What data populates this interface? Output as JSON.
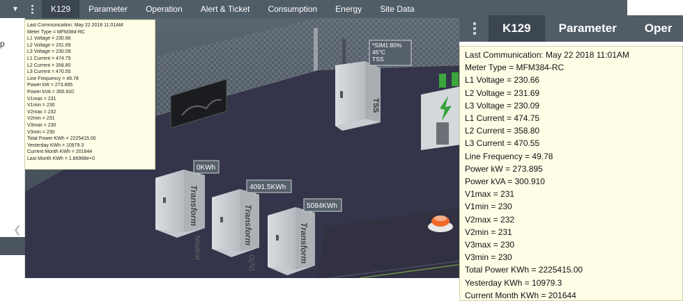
{
  "nav": {
    "tabs": [
      "K129",
      "Parameter",
      "Operation",
      "Alert & Ticket",
      "Consumption",
      "Energy",
      "Site Data"
    ],
    "active": "K129"
  },
  "left_panel": {
    "text": "p"
  },
  "zoom_nav": {
    "tabs": [
      "K129",
      "Parameter",
      "Oper"
    ]
  },
  "scene": {
    "tss_tag": [
      "*SIM1:80%",
      "45°C",
      "TSS"
    ],
    "tss_label": "TSS",
    "transformers": [
      {
        "reading": "0KWh",
        "label": "Transform",
        "sub": "Neutral"
      },
      {
        "reading": "4091.5KWh",
        "label": "Transform",
        "sub": "G(N)"
      },
      {
        "reading": "5084KWh",
        "label": "Transform",
        "sub": ""
      }
    ]
  },
  "meter_info": {
    "lines": [
      "Last Communication: May 22 2018 11:01AM",
      "Meter Type = MFM384-RC",
      "L1 Voltage = 230.66",
      "L2 Voltage = 231.69",
      "L3 Voltage = 230.09",
      "L1 Current = 474.75",
      "L2 Current = 358.80",
      "L3 Current = 470.55",
      "Line Frequency = 49.78",
      "Power kW = 273.895",
      "Power kVA = 300.910",
      "V1max = 231",
      "V1min = 230",
      "V2max = 232",
      "V2min = 231",
      "V3max = 230",
      "V3min = 230",
      "Total Power KWh = 2225415.00",
      "Yesterday KWh = 10979.3",
      "Current Month KWh = 201644",
      "Last Month KWh = 1.86968e+0"
    ]
  },
  "colors": {
    "nav_bg": "#505c66",
    "nav_active": "#3b4650",
    "floor": "#35364a",
    "tooltip_bg": "#fffde6"
  }
}
